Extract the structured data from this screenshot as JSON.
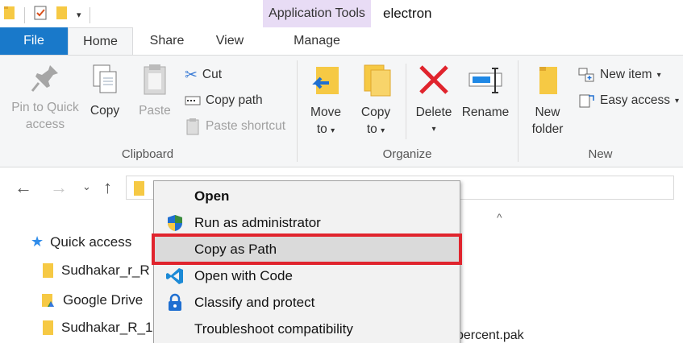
{
  "title_bar": {
    "context_tab": "Application Tools",
    "window_title": "electron"
  },
  "ribbon_tabs": {
    "file": "File",
    "home": "Home",
    "share": "Share",
    "view": "View",
    "manage": "Manage"
  },
  "clipboard": {
    "group_label": "Clipboard",
    "pin_line1": "Pin to Quick",
    "pin_line2": "access",
    "copy": "Copy",
    "paste": "Paste",
    "cut": "Cut",
    "copy_path": "Copy path",
    "paste_shortcut": "Paste shortcut"
  },
  "organize": {
    "group_label": "Organize",
    "move_line1": "Move",
    "move_line2": "to",
    "copy_line1": "Copy",
    "copy_line2": "to",
    "delete": "Delete",
    "rename": "Rename"
  },
  "new_group": {
    "group_label": "New",
    "new_folder_line1": "New",
    "new_folder_line2": "folder",
    "new_item": "New item",
    "easy_access": "Easy access"
  },
  "nav_tree": {
    "quick_access": "Quick access",
    "items": [
      "Sudhakar_r_R",
      "Google Drive",
      "Sudhakar_R_1"
    ]
  },
  "behind_menu_text": "percent.pak",
  "context_menu": {
    "items": [
      {
        "label": "Open",
        "bold": true
      },
      {
        "label": "Run as administrator"
      },
      {
        "label": "Copy as Path",
        "highlighted": true
      },
      {
        "label": "Open with Code"
      },
      {
        "label": "Classify and protect"
      },
      {
        "label": "Troubleshoot compatibility"
      }
    ]
  },
  "colors": {
    "file_tab": "#1979ca",
    "context_tab": "#e8dcf5",
    "highlight_outline": "#e0242d",
    "delete_red": "#e0242d",
    "folder_yellow": "#f6c944",
    "shield_blue": "#1f6fd1",
    "vscode_blue": "#1c8ad6"
  }
}
